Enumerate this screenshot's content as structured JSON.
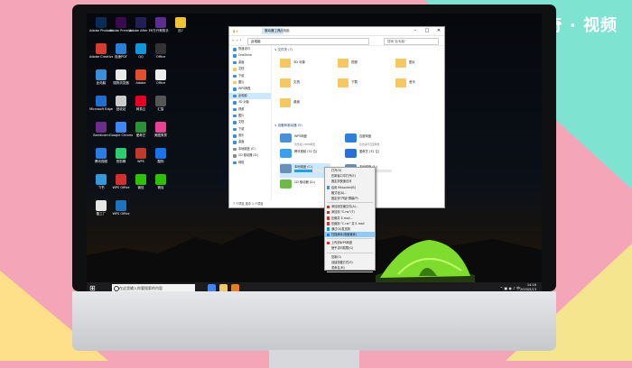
{
  "watermark": {
    "text": "天奇 · 视频"
  },
  "colors": {
    "accent": "#26a0da",
    "folder": "#f5c862",
    "highlight": "#91c9f7"
  },
  "desktop_icons": [
    {
      "label": "Adobe Photoshop",
      "color": "#0a2d57"
    },
    {
      "label": "Adobe Premiere",
      "color": "#3a0a4f"
    },
    {
      "label": "Adobe After Effects",
      "color": "#231e54"
    },
    {
      "label": "万兴神剪手",
      "color": "#5c2d91"
    },
    {
      "label": "迅7",
      "color": "#f1c232"
    },
    {
      "label": "Adobe Creative",
      "color": "#d83b2f"
    },
    {
      "label": "极速PDF",
      "color": "#2a7fd5"
    },
    {
      "label": "QQ",
      "color": "#1296db"
    },
    {
      "label": "Office",
      "color": "#333333"
    },
    {
      "label": "此电脑",
      "color": "#3c8dd8"
    },
    {
      "label": "搜狗浏览器",
      "color": "#e9e9e9"
    },
    {
      "label": "Adobe",
      "color": "#e14f2d"
    },
    {
      "label": "Office",
      "color": "#eeeeee"
    },
    {
      "label": "Microsoft Edge",
      "color": "#1f6fd0"
    },
    {
      "label": "回收站",
      "color": "#cccccc"
    },
    {
      "label": "网易云",
      "color": "#e60026"
    },
    {
      "label": "汇智",
      "color": "#555555"
    },
    {
      "label": "Bandicam",
      "color": "#6a2e8a"
    },
    {
      "label": "Google Chrome",
      "color": "#4285f4"
    },
    {
      "label": "爱奇艺",
      "color": "#2c8f3a"
    },
    {
      "label": "美图秀秀",
      "color": "#e84393"
    },
    {
      "label": "腾讯视频",
      "color": "#2b7be4"
    },
    {
      "label": "快剪辑",
      "color": "#2ecc71"
    },
    {
      "label": "WPS",
      "color": "#c0392b"
    },
    {
      "label": "酷狗",
      "color": "#1a73e8"
    },
    {
      "label": "飞书",
      "color": "#3498db"
    },
    {
      "label": "WPS Office",
      "color": "#d32f2f"
    },
    {
      "label": "微信",
      "color": "#2dc100"
    },
    {
      "label": "微信",
      "color": "#2dc100"
    },
    {
      "label": "酷工厂",
      "color": "#e6e6e6"
    },
    {
      "label": "WPS Office",
      "color": "#1e73be"
    }
  ],
  "taskbar": {
    "search_placeholder": "在这里输入你要搜索的内容",
    "time": "14:16",
    "date": "2020/5/13"
  },
  "explorer": {
    "title": "此电脑",
    "tab_manage": "驱动器工具",
    "tab_name": "此电脑",
    "address": "此电脑",
    "search_placeholder": "搜索\"此电脑\"",
    "status": "7 个项目   选中 1 个项目",
    "nav": [
      {
        "label": "快速访问",
        "color": "#3c8dd8"
      },
      {
        "label": "OneDrive",
        "color": "#3c8dd8"
      },
      {
        "label": "桌面",
        "color": "#3c8dd8"
      },
      {
        "label": "文档",
        "color": "#f5c862"
      },
      {
        "label": "下载",
        "color": "#3c8dd8"
      },
      {
        "label": "图片",
        "color": "#f5c862"
      },
      {
        "label": "WPS网盘",
        "color": "#3c8dd8"
      },
      {
        "label": "此电脑",
        "color": "#3c8dd8"
      },
      {
        "label": "3D 对象",
        "color": "#3c8dd8"
      },
      {
        "label": "视频",
        "color": "#3c8dd8"
      },
      {
        "label": "图片",
        "color": "#3c8dd8"
      },
      {
        "label": "文档",
        "color": "#3c8dd8"
      },
      {
        "label": "下载",
        "color": "#3c8dd8"
      },
      {
        "label": "音乐",
        "color": "#3c8dd8"
      },
      {
        "label": "桌面",
        "color": "#3c8dd8"
      },
      {
        "label": "本地磁盘 (C:)",
        "color": "#888888"
      },
      {
        "label": "CD 驱动器 (D:)",
        "color": "#888888"
      },
      {
        "label": "网络",
        "color": "#3c8dd8"
      }
    ],
    "folders_header": "∨ 文件夹 (7)",
    "folders": [
      {
        "label": "3D 对象"
      },
      {
        "label": "视频"
      },
      {
        "label": "图片"
      },
      {
        "label": "文档"
      },
      {
        "label": "下载"
      },
      {
        "label": "音乐"
      },
      {
        "label": "桌面"
      }
    ],
    "drives_header": "∨ 设备和驱动器 (5)",
    "drives": [
      {
        "label": "WPS网盘",
        "sub": "双击进入WPS网盘",
        "color": "#4a90d9",
        "usage": 0
      },
      {
        "label": "百度网盘",
        "sub": "双击运行百度网盘",
        "color": "#2f7fd8",
        "usage": 0
      },
      {
        "label": "腾讯视频 (32 位)",
        "sub": "",
        "color": "#3a9df0",
        "usage": 0
      },
      {
        "label": "爱奇艺 (32 位)",
        "sub": "",
        "color": "#2b6ed6",
        "usage": 0
      },
      {
        "label": "本地磁盘 (C:)",
        "sub": "",
        "color": "#6b8fb6",
        "usage": 0.55
      },
      {
        "label": "本地磁盘 (E:)",
        "sub": "",
        "color": "#6b8fb6",
        "usage": 0.2
      },
      {
        "label": "CD 驱动器 (D:)",
        "sub": "",
        "color": "#6fb84a",
        "usage": 0
      }
    ]
  },
  "context_menu": {
    "items": [
      {
        "label": "打开(O)",
        "sep_after": false,
        "hl": false,
        "icon": ""
      },
      {
        "label": "在新窗口中打开(E)",
        "sep_after": false,
        "hl": false,
        "icon": ""
      },
      {
        "label": "固定到快速访问",
        "sep_after": false,
        "hl": false,
        "icon": ""
      },
      {
        "label": "启用 BitLocker(B)",
        "sep_after": false,
        "hl": false,
        "icon": "#4a90d9"
      },
      {
        "label": "格式化(A)...",
        "sep_after": false,
        "hl": false,
        "icon": ""
      },
      {
        "label": "固定到\"开始\"屏幕(P)",
        "sep_after": true,
        "hl": false,
        "icon": ""
      },
      {
        "label": "添加到压缩文件(A)...",
        "sep_after": false,
        "hl": false,
        "icon": "#c0392b"
      },
      {
        "label": "添加到 \"C.rar\"(T)",
        "sep_after": false,
        "hl": false,
        "icon": "#c0392b"
      },
      {
        "label": "压缩并 E-mail...",
        "sep_after": false,
        "hl": false,
        "icon": "#c0392b"
      },
      {
        "label": "压缩到 \"C.rar\" 并 E-mail",
        "sep_after": false,
        "hl": false,
        "icon": "#c0392b"
      },
      {
        "label": "通过QQ发送到",
        "sep_after": false,
        "hl": false,
        "icon": "#1296db"
      },
      {
        "label": "扫描病毒(电脑管家)",
        "sep_after": true,
        "hl": true,
        "icon": "#2b7be4"
      },
      {
        "label": "上传到WPS网盘",
        "sep_after": false,
        "hl": false,
        "icon": "#d32f2f"
      },
      {
        "label": "授予访问权限(G)",
        "sep_after": true,
        "hl": false,
        "icon": ""
      },
      {
        "label": "复制(C)",
        "sep_after": false,
        "hl": false,
        "icon": ""
      },
      {
        "label": "创建快捷方式(S)",
        "sep_after": false,
        "hl": false,
        "icon": ""
      },
      {
        "label": "重命名(M)",
        "sep_after": true,
        "hl": false,
        "icon": ""
      },
      {
        "label": "属性(R)",
        "sep_after": false,
        "hl": false,
        "icon": ""
      }
    ]
  }
}
